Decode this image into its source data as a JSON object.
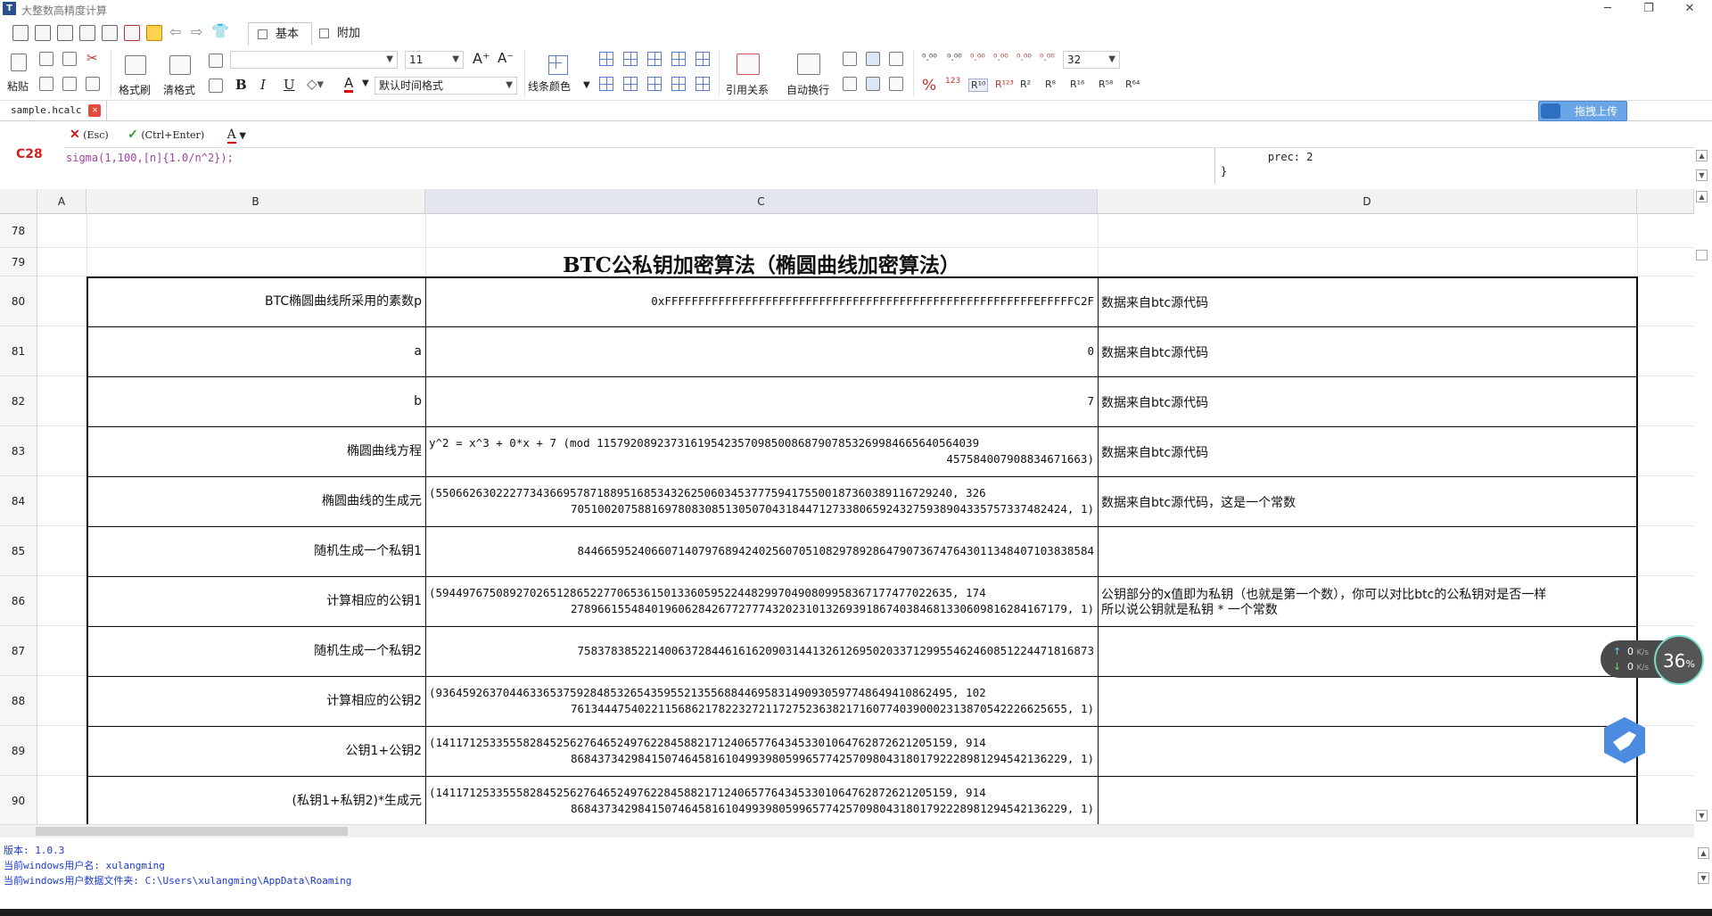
{
  "window": {
    "title": "大整数高精度计算",
    "controls": [
      "─",
      "❐",
      "✕"
    ]
  },
  "top_tabs": [
    {
      "label": "基本"
    },
    {
      "label": "附加"
    }
  ],
  "ribbon": {
    "paste_label": "粘贴",
    "format_brush_label": "格式刷",
    "clear_format_label": "清格式",
    "font_name_value": "",
    "font_size_value": "11",
    "time_format_value": "默认时间格式",
    "line_color_label": "线条颜色",
    "reference_label": "引用关系",
    "auto_wrap_label": "自动换行",
    "precision_value": "32",
    "bold": "B",
    "italic": "I",
    "underline": "U",
    "font_color": "A",
    "grow_font": "A⁺",
    "shrink_font": "A⁻",
    "percent": "%",
    "radix_buttons": [
      "R¹⁰",
      "R¹²³",
      "R²",
      "R⁸",
      "R¹⁶",
      "R⁵⁸",
      "R⁶⁴"
    ],
    "decimal_buttons": [
      "⁰.⁰⁰",
      "⁰.⁰⁰",
      "⁰.⁰⁰",
      "⁰.⁰⁰",
      "⁰.⁰⁰",
      "⁰.⁰⁰"
    ],
    "num_red": "123"
  },
  "doc_tab": {
    "label": "sample.hcalc"
  },
  "upload_button": {
    "label": "拖拽上传"
  },
  "formula_bar": {
    "cell_ref": "C28",
    "cancel_label": "(Esc)",
    "confirm_label": "(Ctrl+Enter)",
    "font_btn": "A",
    "formula": "sigma(1,100,[n]{1.0/n^2});",
    "options_line1": "    prec: 2",
    "options_line2": "}"
  },
  "columns": [
    {
      "label": ""
    },
    {
      "label": "A"
    },
    {
      "label": "B"
    },
    {
      "label": "C"
    },
    {
      "label": "D"
    }
  ],
  "sheet": {
    "title": "BTC公私钥加密算法（椭圆曲线加密算法）",
    "rows": [
      {
        "num": "78",
        "b": "",
        "c1": "",
        "c2": "",
        "d1": "",
        "d2": ""
      },
      {
        "num": "79",
        "b": "",
        "c1": "",
        "c2": "",
        "d1": "",
        "d2": ""
      },
      {
        "num": "80",
        "b": "BTC椭圆曲线所采用的素数p",
        "c1": "0xFFFFFFFFFFFFFFFFFFFFFFFFFFFFFFFFFFFFFFFFFFFFFFFFFFFFFFFEFFFFFC2F",
        "c2": "",
        "d1": "数据来自btc源代码",
        "d2": ""
      },
      {
        "num": "81",
        "b": "a",
        "c1": "0",
        "c2": "",
        "d1": "数据来自btc源代码",
        "d2": ""
      },
      {
        "num": "82",
        "b": "b",
        "c1": "7",
        "c2": "",
        "d1": "数据来自btc源代码",
        "d2": ""
      },
      {
        "num": "83",
        "b": "椭圆曲线方程",
        "c1": "y^2 = x^3 + 0*x + 7 (mod 115792089237316195423570985008687907853269984665640564039",
        "c2": "457584007908834671663)",
        "d1": "数据来自btc源代码",
        "d2": ""
      },
      {
        "num": "84",
        "b": "椭圆曲线的生成元",
        "c1": "(55066263022277343669578718895168534326250603453777594175500187360389116729240, 326",
        "c2": "70510020758816978083085130507043184471273380659243275938904335757337482424, 1)",
        "d1": "数据来自btc源代码，这是一个常数",
        "d2": ""
      },
      {
        "num": "85",
        "b": "随机生成一个私钥1",
        "c1": "84466595240660714079768942402560705108297892864790736747643011348407103838584",
        "c2": "",
        "d1": "",
        "d2": ""
      },
      {
        "num": "86",
        "b": "计算相应的公钥1",
        "c1": "(59449767508927026512865227706536150133605952244829970490809958367177477022635, 174",
        "c2": "27896615548401960628426772777432023101326939186740384681330609816284167179, 1)",
        "d1": "公钥部分的x值即为私钥（也就是第一个数），你可以对比btc的公私钥对是否一样",
        "d2": "所以说公钥就是私钥 * 一个常数"
      },
      {
        "num": "87",
        "b": "随机生成一个私钥2",
        "c1": "75837838522140063728446161620903144132612695020337129955462460851224471816873",
        "c2": "",
        "d1": "",
        "d2": ""
      },
      {
        "num": "88",
        "b": "计算相应的公钥2",
        "c1": "(93645926370446336537592848532654359552135568844695831490930597748649410862495, 102",
        "c2": "76134447540221156862178223272117275236382171607740390002313870542226625655, 1)",
        "d1": "",
        "d2": ""
      },
      {
        "num": "89",
        "b": "公钥1+公钥2",
        "c1": "(14117125335558284525627646524976228458821712406577643453301064762872621205159, 914",
        "c2": "86843734298415074645816104993980599657742570980431801792228981294542136229, 1)",
        "d1": "",
        "d2": ""
      },
      {
        "num": "90",
        "b": "(私钥1+私钥2)*生成元",
        "c1": "(14117125335558284525627646524976228458821712406577643453301064762872621205159, 914",
        "c2": "86843734298415074645816104993980599657742570980431801792228981294542136229, 1)",
        "d1": "",
        "d2": ""
      }
    ]
  },
  "log": [
    "版本: 1.0.3",
    "当前windows用户名: xulangming",
    "当前windows用户数据文件夹: C:\\Users\\xulangming\\AppData\\Roaming"
  ],
  "net_widget": {
    "up": "0",
    "down": "0",
    "unit": "K/s",
    "percent": "36",
    "percent_sign": "%"
  }
}
